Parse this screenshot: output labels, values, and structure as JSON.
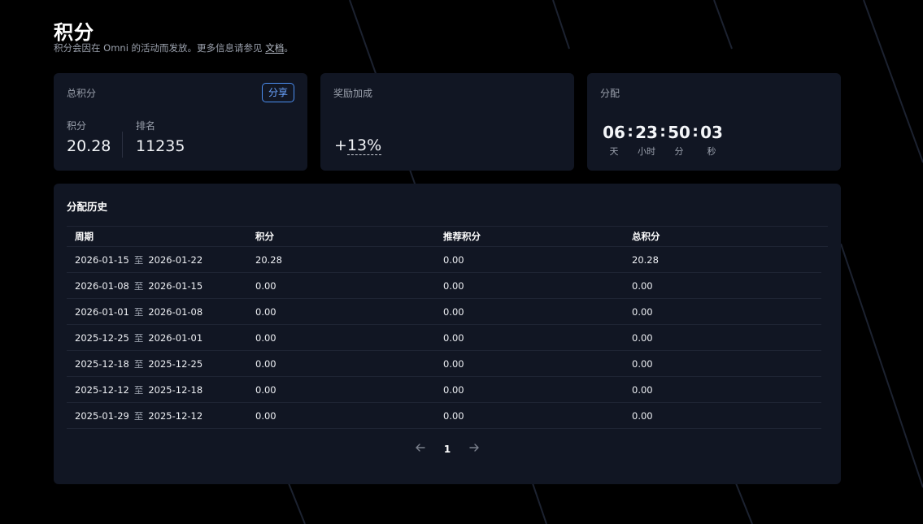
{
  "header": {
    "title": "积分",
    "subtitle_text": "积分会因在 Omni 的活动而发放。更多信息请参见 ",
    "subtitle_link": "文档",
    "subtitle_end": "。"
  },
  "total_points_card": {
    "label": "总积分",
    "share_label": "分享",
    "points_label": "积分",
    "points_value": "20.28",
    "rank_label": "排名",
    "rank_value": "11235"
  },
  "bonus_card": {
    "label": "奖励加成",
    "prefix": "+",
    "value": "13%"
  },
  "distribution_card": {
    "label": "分配",
    "countdown": [
      {
        "value": "06",
        "unit": "天"
      },
      {
        "value": "23",
        "unit": "小时"
      },
      {
        "value": "50",
        "unit": "分"
      },
      {
        "value": "03",
        "unit": "秒"
      }
    ]
  },
  "history": {
    "title": "分配历史",
    "columns": [
      "周期",
      "积分",
      "推荐积分",
      "总积分"
    ],
    "to_label": "至",
    "rows": [
      {
        "start": "2026-01-15",
        "end": "2026-01-22",
        "points": "20.28",
        "referral": "0.00",
        "total": "20.28"
      },
      {
        "start": "2026-01-08",
        "end": "2026-01-15",
        "points": "0.00",
        "referral": "0.00",
        "total": "0.00"
      },
      {
        "start": "2026-01-01",
        "end": "2026-01-08",
        "points": "0.00",
        "referral": "0.00",
        "total": "0.00"
      },
      {
        "start": "2025-12-25",
        "end": "2026-01-01",
        "points": "0.00",
        "referral": "0.00",
        "total": "0.00"
      },
      {
        "start": "2025-12-18",
        "end": "2025-12-25",
        "points": "0.00",
        "referral": "0.00",
        "total": "0.00"
      },
      {
        "start": "2025-12-12",
        "end": "2025-12-18",
        "points": "0.00",
        "referral": "0.00",
        "total": "0.00"
      },
      {
        "start": "2025-01-29",
        "end": "2025-12-12",
        "points": "0.00",
        "referral": "0.00",
        "total": "0.00"
      }
    ],
    "pagination": {
      "prev_icon": "arrow-left-icon",
      "current_page": "1",
      "next_icon": "arrow-right-icon"
    }
  },
  "colors": {
    "background": "#000000",
    "card": "#111623",
    "accent": "#4b8ef1",
    "muted_text": "#9aa0ac"
  }
}
